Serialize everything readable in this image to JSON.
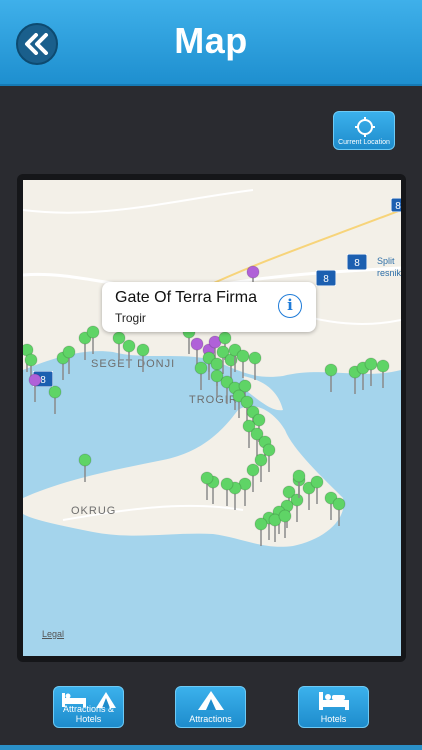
{
  "header": {
    "title": "Map",
    "back_icon": "double-chevron-left-icon"
  },
  "current_location": {
    "label": "Current Location",
    "icon": "crosshair-icon"
  },
  "map": {
    "place_labels": [
      "SEGET DONJI",
      "TROGIR",
      "OKRUG",
      "Split",
      "resnik"
    ],
    "road_shields": [
      "8",
      "8",
      "8",
      "8"
    ],
    "legal": "Legal",
    "callout": {
      "title": "Gate Of Terra Firma",
      "subtitle": "Trogir",
      "info_icon": "info-icon"
    }
  },
  "bottom": {
    "attractions_hotels": "Attractions & Hotels",
    "attractions": "Attractions",
    "hotels": "Hotels"
  },
  "colors": {
    "accent": "#2a9fe0",
    "pin_green": "#5fd466",
    "pin_purple": "#b061d8",
    "water": "#a4d4ec",
    "land": "#f3f0e8"
  }
}
